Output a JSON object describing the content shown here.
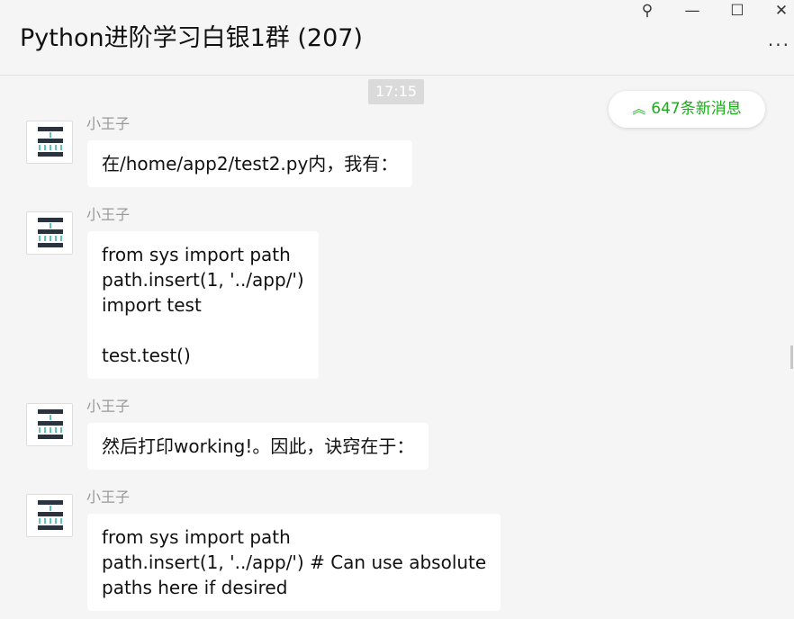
{
  "window": {
    "title": "Python进阶学习白银1群 (207)",
    "pin": "⚲",
    "minimize": "—",
    "maximize": "☐",
    "close": "✕",
    "more": "···"
  },
  "chat": {
    "timestamp": "17:15",
    "new_messages": "647条新消息",
    "messages": [
      {
        "sender": "小王子",
        "text": "在/home/app2/test2.py内，我有："
      },
      {
        "sender": "小王子",
        "text": "from sys import path\npath.insert(1, '../app/')\nimport test\n\ntest.test()"
      },
      {
        "sender": "小王子",
        "text": "然后打印working!。因此，诀窍在于："
      },
      {
        "sender": "小王子",
        "text": "from sys import path\npath.insert(1, '../app/') # Can use absolute\npaths here if desired"
      }
    ]
  },
  "colors": {
    "accent": "#1aad19",
    "background": "#f5f5f5",
    "bubble": "#ffffff"
  },
  "icons": [
    "pin-icon",
    "minimize-icon",
    "maximize-icon",
    "close-icon",
    "more-icon",
    "double-chevron-up-icon"
  ]
}
